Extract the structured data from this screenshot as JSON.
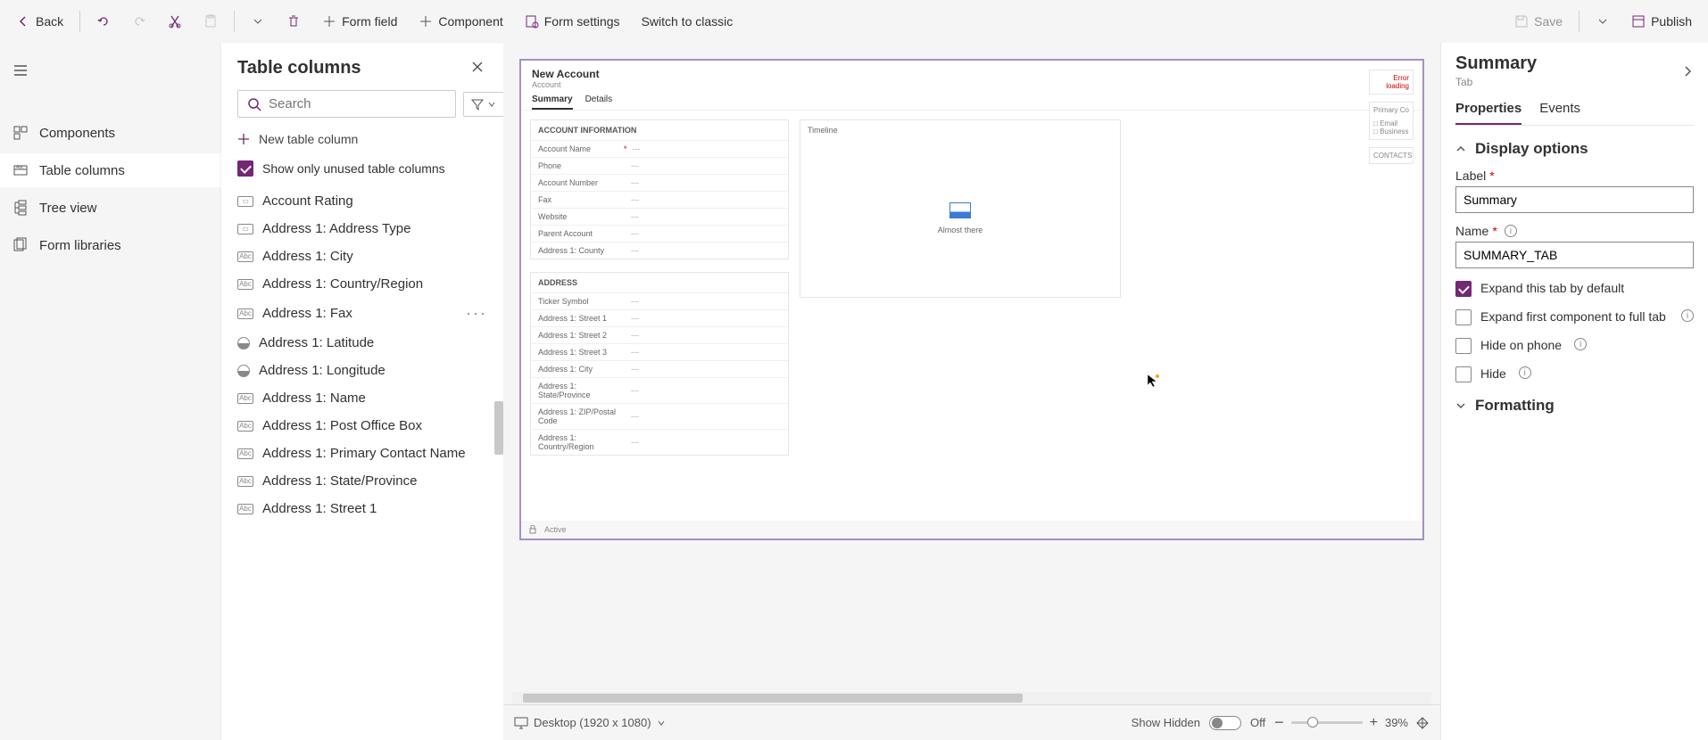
{
  "toolbar": {
    "back": "Back",
    "form_field": "Form field",
    "component": "Component",
    "form_settings": "Form settings",
    "switch": "Switch to classic",
    "save": "Save",
    "publish": "Publish"
  },
  "leftnav": {
    "items": [
      {
        "label": "Components"
      },
      {
        "label": "Table columns"
      },
      {
        "label": "Tree view"
      },
      {
        "label": "Form libraries"
      }
    ]
  },
  "panel": {
    "title": "Table columns",
    "search_placeholder": "Search",
    "new_column": "New table column",
    "unused_only": "Show only unused table columns",
    "columns": [
      {
        "label": "Account Rating",
        "type": "opt"
      },
      {
        "label": "Address 1: Address Type",
        "type": "opt"
      },
      {
        "label": "Address 1: City",
        "type": "abc"
      },
      {
        "label": "Address 1: Country/Region",
        "type": "abc"
      },
      {
        "label": "Address 1: Fax",
        "type": "abc",
        "more": true
      },
      {
        "label": "Address 1: Latitude",
        "type": "globe"
      },
      {
        "label": "Address 1: Longitude",
        "type": "globe"
      },
      {
        "label": "Address 1: Name",
        "type": "abc"
      },
      {
        "label": "Address 1: Post Office Box",
        "type": "abc"
      },
      {
        "label": "Address 1: Primary Contact Name",
        "type": "abc"
      },
      {
        "label": "Address 1: State/Province",
        "type": "abc"
      },
      {
        "label": "Address 1: Street 1",
        "type": "abc"
      }
    ]
  },
  "form": {
    "title": "New Account",
    "subtitle": "Account",
    "tabs": [
      "Summary",
      "Details"
    ],
    "section1": {
      "title": "ACCOUNT INFORMATION",
      "fields": [
        {
          "label": "Account Name",
          "req": true
        },
        {
          "label": "Phone"
        },
        {
          "label": "Account Number"
        },
        {
          "label": "Fax"
        },
        {
          "label": "Website"
        },
        {
          "label": "Parent Account"
        },
        {
          "label": "Address 1: County"
        }
      ]
    },
    "section2": {
      "title": "ADDRESS",
      "fields": [
        {
          "label": "Ticker Symbol"
        },
        {
          "label": "Address 1: Street 1"
        },
        {
          "label": "Address 1: Street 2"
        },
        {
          "label": "Address 1: Street 3"
        },
        {
          "label": "Address 1: City"
        },
        {
          "label": "Address 1: State/Province"
        },
        {
          "label": "Address 1: ZIP/Postal Code"
        },
        {
          "label": "Address 1: Country/Region"
        }
      ]
    },
    "timeline": {
      "title": "Timeline",
      "status": "Almost there"
    },
    "side": {
      "err": "Error loading",
      "primary": "Primary Co",
      "email": "Email",
      "business": "Business",
      "contacts": "CONTACTS"
    },
    "footer": {
      "status": "Active"
    }
  },
  "footer": {
    "device": "Desktop (1920 x 1080)",
    "show_hidden": "Show Hidden",
    "toggle": "Off",
    "zoom": "39%"
  },
  "props": {
    "title": "Summary",
    "subtitle": "Tab",
    "tabs": [
      "Properties",
      "Events"
    ],
    "display_options": "Display options",
    "label_label": "Label",
    "label_value": "Summary",
    "name_label": "Name",
    "name_value": "SUMMARY_TAB",
    "expand_default": "Expand this tab by default",
    "expand_first": "Expand first component to full tab",
    "hide_phone": "Hide on phone",
    "hide": "Hide",
    "formatting": "Formatting"
  }
}
